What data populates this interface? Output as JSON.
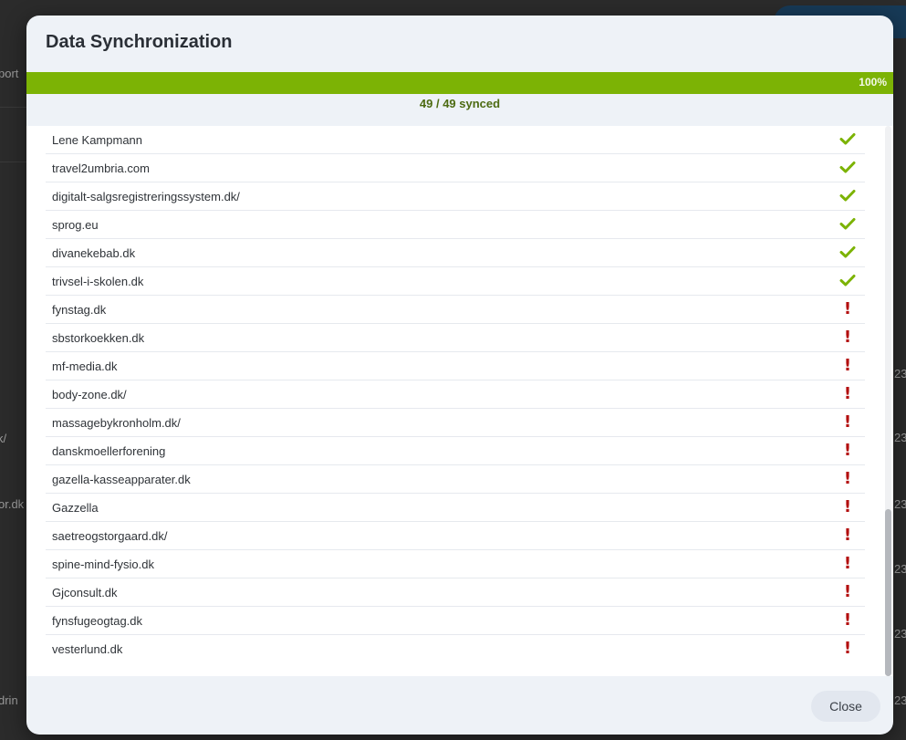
{
  "background": {
    "left_fragments": [
      "port",
      "k/",
      "or.dk",
      "drin"
    ],
    "right_fragments": [
      "23",
      "23",
      "23",
      "23",
      "23",
      "23",
      "23"
    ]
  },
  "dialog": {
    "title": "Data Synchronization",
    "progress": {
      "percent_label": "100%",
      "fraction": 1.0,
      "fill_color": "#7cb305"
    },
    "sync_count": "49 / 49 synced",
    "status_colors": {
      "success": "#7cb305",
      "error": "#b30e0e"
    },
    "items": [
      {
        "name": "Lene Kampmann",
        "status": "success",
        "icon": "check-icon"
      },
      {
        "name": "travel2umbria.com",
        "status": "success",
        "icon": "check-icon"
      },
      {
        "name": "digitalt-salgsregistreringssystem.dk/",
        "status": "success",
        "icon": "check-icon"
      },
      {
        "name": "sprog.eu",
        "status": "success",
        "icon": "check-icon"
      },
      {
        "name": "divanekebab.dk",
        "status": "success",
        "icon": "check-icon"
      },
      {
        "name": "trivsel-i-skolen.dk",
        "status": "success",
        "icon": "check-icon"
      },
      {
        "name": "fynstag.dk",
        "status": "error",
        "icon": "exclamation-icon"
      },
      {
        "name": "sbstorkoekken.dk",
        "status": "error",
        "icon": "exclamation-icon"
      },
      {
        "name": "mf-media.dk",
        "status": "error",
        "icon": "exclamation-icon"
      },
      {
        "name": "body-zone.dk/",
        "status": "error",
        "icon": "exclamation-icon"
      },
      {
        "name": "massagebykronholm.dk/",
        "status": "error",
        "icon": "exclamation-icon"
      },
      {
        "name": "danskmoellerforening",
        "status": "error",
        "icon": "exclamation-icon"
      },
      {
        "name": "gazella-kasseapparater.dk",
        "status": "error",
        "icon": "exclamation-icon"
      },
      {
        "name": "Gazzella",
        "status": "error",
        "icon": "exclamation-icon"
      },
      {
        "name": "saetreogstorgaard.dk/",
        "status": "error",
        "icon": "exclamation-icon"
      },
      {
        "name": "spine-mind-fysio.dk",
        "status": "error",
        "icon": "exclamation-icon"
      },
      {
        "name": "Gjconsult.dk",
        "status": "error",
        "icon": "exclamation-icon"
      },
      {
        "name": "fynsfugeogtag.dk",
        "status": "error",
        "icon": "exclamation-icon"
      },
      {
        "name": "vesterlund.dk",
        "status": "error",
        "icon": "exclamation-icon"
      }
    ],
    "close_label": "Close"
  }
}
